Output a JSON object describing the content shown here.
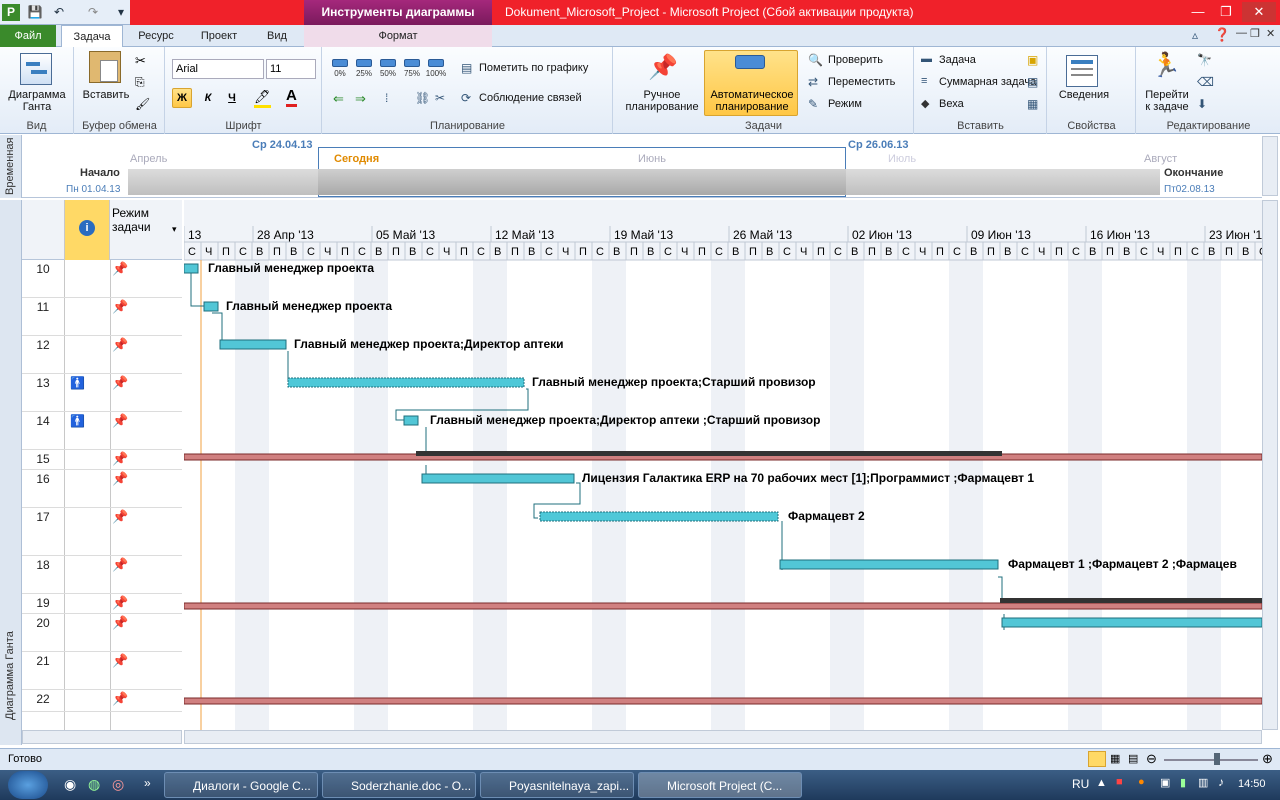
{
  "titlebar": {
    "context_tab": "Инструменты диаграммы Ганта",
    "document": "Dokument_Microsoft_Project  -  Microsoft Project (Сбой активации продукта)"
  },
  "tabs": {
    "file": "Файл",
    "task": "Задача",
    "resource": "Ресурс",
    "project": "Проект",
    "view": "Вид",
    "format": "Формат"
  },
  "ribbon": {
    "view_group": {
      "button": "Диаграмма\nГанта",
      "label": "Вид"
    },
    "clipboard": {
      "paste": "Вставить",
      "label": "Буфер обмена"
    },
    "font": {
      "name": "Arial",
      "size": "11",
      "bold": "Ж",
      "italic": "К",
      "underline": "Ч",
      "label": "Шрифт"
    },
    "schedule": {
      "pcts": [
        "0%",
        "25%",
        "50%",
        "75%",
        "100%"
      ],
      "mark": "Пометить по графику",
      "respect": "Соблюдение связей",
      "label": "Планирование"
    },
    "tasks": {
      "manual": "Ручное\nпланирование",
      "auto": "Автоматическое\nпланирование",
      "inspect": "Проверить",
      "move": "Переместить",
      "mode": "Режим",
      "label": "Задачи"
    },
    "insert": {
      "task": "Задача",
      "summary": "Суммарная задача",
      "milestone": "Веха",
      "label": "Вставить"
    },
    "properties": {
      "info": "Сведения",
      "label": "Свойства"
    },
    "editing": {
      "goto": "Перейти\nк задаче",
      "label": "Редактирование"
    }
  },
  "timeline": {
    "side_label": "Временная",
    "start_label": "Начало",
    "start_date": "Пн 01.04.13",
    "finish_label": "Окончание",
    "finish_date": "Пт02.08.13",
    "left_date": "Ср 24.04.13",
    "right_date": "Ср 26.06.13",
    "today": "Сегодня",
    "months": [
      "Апрель",
      "Июнь",
      "Июль",
      "Август"
    ]
  },
  "gantt": {
    "side_label": "Диаграмма Ганта",
    "col_mode": "Режим\nзадачи",
    "weeks": [
      "13",
      "28 Апр '13",
      "05 Май '13",
      "12 Май '13",
      "19 Май '13",
      "26 Май '13",
      "02 Июн '13",
      "09 Июн '13",
      "16 Июн '13",
      "23 Июн '13"
    ],
    "days": [
      "С",
      "Ч",
      "П",
      "С",
      "В",
      "П",
      "В",
      "С",
      "Ч",
      "П",
      "С",
      "В",
      "П",
      "В",
      "С",
      "Ч",
      "П",
      "С",
      "В",
      "П",
      "В",
      "С",
      "Ч",
      "П",
      "С",
      "В",
      "П",
      "В",
      "С",
      "Ч",
      "П",
      "С",
      "В",
      "П",
      "В",
      "С",
      "Ч",
      "П",
      "С",
      "В",
      "П",
      "В",
      "С",
      "Ч",
      "П",
      "С",
      "В",
      "П",
      "В",
      "С",
      "Ч",
      "П",
      "С",
      "В",
      "П",
      "В",
      "С",
      "Ч",
      "П",
      "С",
      "В",
      "П",
      "В",
      "С",
      "Ч",
      "П",
      "С",
      "В",
      "П",
      "В"
    ],
    "rows": [
      {
        "id": "10",
        "label": "Главный менеджер проекта",
        "indicator": ""
      },
      {
        "id": "11",
        "label": "Главный менеджер проекта",
        "indicator": ""
      },
      {
        "id": "12",
        "label": "Главный менеджер проекта;Директор аптеки",
        "indicator": ""
      },
      {
        "id": "13",
        "label": "Главный менеджер проекта;Старший провизор",
        "indicator": "!"
      },
      {
        "id": "14",
        "label": "Главный менеджер проекта;Директор аптеки ;Старший провизор",
        "indicator": "!"
      },
      {
        "id": "15",
        "label": "",
        "indicator": ""
      },
      {
        "id": "16",
        "label": "Лицензия Галактика ERP на 70 рабочих мест [1];Программист ;Фармацевт 1",
        "indicator": ""
      },
      {
        "id": "17",
        "label": "Фармацевт 2",
        "indicator": ""
      },
      {
        "id": "18",
        "label": "Фармацевт 1 ;Фармацевт 2 ;Фармацев",
        "indicator": ""
      },
      {
        "id": "19",
        "label": "",
        "indicator": ""
      },
      {
        "id": "20",
        "label": "",
        "indicator": ""
      },
      {
        "id": "21",
        "label": "",
        "indicator": ""
      },
      {
        "id": "22",
        "label": "",
        "indicator": ""
      }
    ]
  },
  "statusbar": {
    "status": "Готово"
  },
  "taskbar": {
    "items": [
      "Диалоги - Google C...",
      "Soderzhanie.doc - O...",
      "Poyasnitelnaya_zapi...",
      "Microsoft Project (C..."
    ],
    "lang": "RU",
    "time": "14:50"
  }
}
